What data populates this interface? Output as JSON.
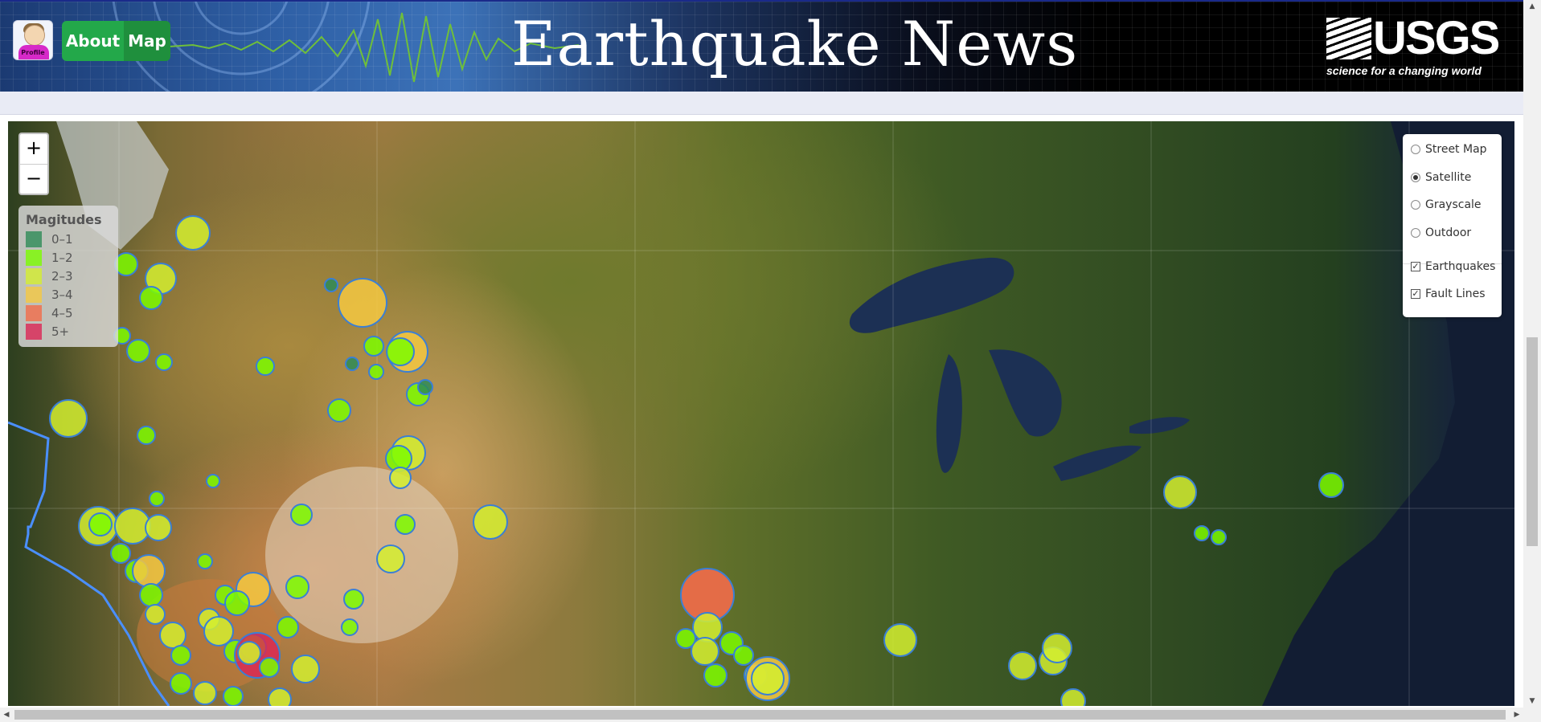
{
  "header": {
    "profile_label": "Profile",
    "nav": {
      "about": "About",
      "map": "Map"
    },
    "title": "Earthquake News",
    "logo": {
      "letters": "USGS",
      "tagline": "science for a changing world"
    }
  },
  "map": {
    "zoom": {
      "in": "+",
      "out": "−"
    },
    "legend": {
      "title": "Magitudes",
      "items": [
        {
          "label": "0–1",
          "color": "#2e8b57"
        },
        {
          "label": "1–2",
          "color": "#7cfc00"
        },
        {
          "label": "2–3",
          "color": "#d4ee30"
        },
        {
          "label": "3–4",
          "color": "#f5c842"
        },
        {
          "label": "4–5",
          "color": "#f26b4a"
        },
        {
          "label": "5+",
          "color": "#dc2455"
        }
      ]
    },
    "layers": {
      "base": [
        {
          "label": "Street Map",
          "selected": false
        },
        {
          "label": "Satellite",
          "selected": true
        },
        {
          "label": "Grayscale",
          "selected": false
        },
        {
          "label": "Outdoor",
          "selected": false
        }
      ],
      "overlays": [
        {
          "label": "Earthquakes",
          "checked": true
        },
        {
          "label": "Fault Lines",
          "checked": true
        }
      ]
    }
  }
}
